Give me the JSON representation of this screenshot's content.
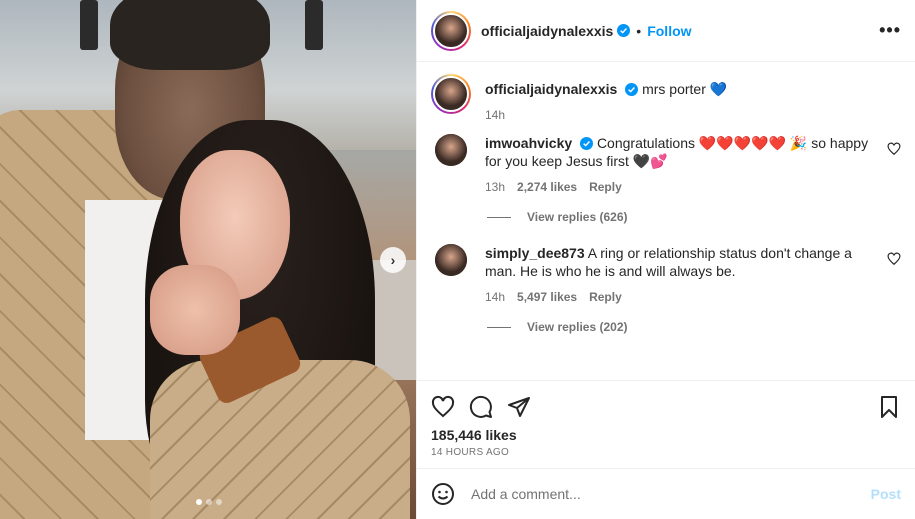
{
  "post": {
    "username": "officialjaidynalexxis",
    "follow_label": "Follow",
    "caption": "mrs porter 💙",
    "caption_time": "14h"
  },
  "comments": [
    {
      "username": "imwoahvicky",
      "text": "Congratulations ❤️❤️❤️❤️❤️ 🎉 so happy for you keep Jesus first 🖤💕",
      "time": "13h",
      "likes": "2,274 likes",
      "reply_label": "Reply",
      "view_replies": "View replies (626)"
    },
    {
      "username": "simply_dee873",
      "text": "A ring or relationship status don't change a man. He is who he is and will always be.",
      "time": "14h",
      "likes": "5,497 likes",
      "reply_label": "Reply",
      "view_replies": "View replies (202)"
    }
  ],
  "stats": {
    "likes": "185,446 likes",
    "time_ago": "14 HOURS AGO"
  },
  "composer": {
    "placeholder": "Add a comment...",
    "post_label": "Post"
  },
  "colors": {
    "accent": "#0095f6",
    "verified": "#0095f6",
    "muted": "#737373",
    "post_disabled": "#b2dffc"
  },
  "carousel": {
    "current": 1,
    "total": 3
  }
}
